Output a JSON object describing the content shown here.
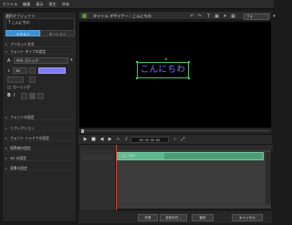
{
  "menu": {
    "items": [
      "ファイル",
      "編集",
      "表示",
      "再生",
      "共有"
    ]
  },
  "dialog": {
    "title": "タイトル デザイナー : こんにちわ",
    "font_dropdown": "フォ"
  },
  "left_panel": {
    "object_label": "選択オブジェクト:",
    "object_item": "T こんにちわ",
    "tabs": [
      "テキスト",
      "モーション"
    ],
    "sections": {
      "preset": "プリセット文字",
      "font_type": "フォント タイプの設定",
      "font_name": "ＭＳ ゴシック",
      "font_size": "36",
      "kerning": "カーニング",
      "bold": "B",
      "italic": "I",
      "font_settings": "フォントの設定",
      "reflection": "リフレクション",
      "font_shadow": "フォント シャドウの設定",
      "border": "境界線の設定",
      "d3": "3D の設定",
      "background": "背景の設定"
    },
    "colors": {
      "swatch": "#7d7cf2"
    }
  },
  "preview": {
    "text": "こんにちわ",
    "text_color": "#7d6cff",
    "box_color": "#3cc96b"
  },
  "transport": {
    "timecode": "00 00 00 00"
  },
  "timeline": {
    "clip_label": "こんにちわ"
  },
  "footer": {
    "buttons": [
      "共有",
      "名前を付...",
      "保存",
      "キャンセル"
    ]
  }
}
